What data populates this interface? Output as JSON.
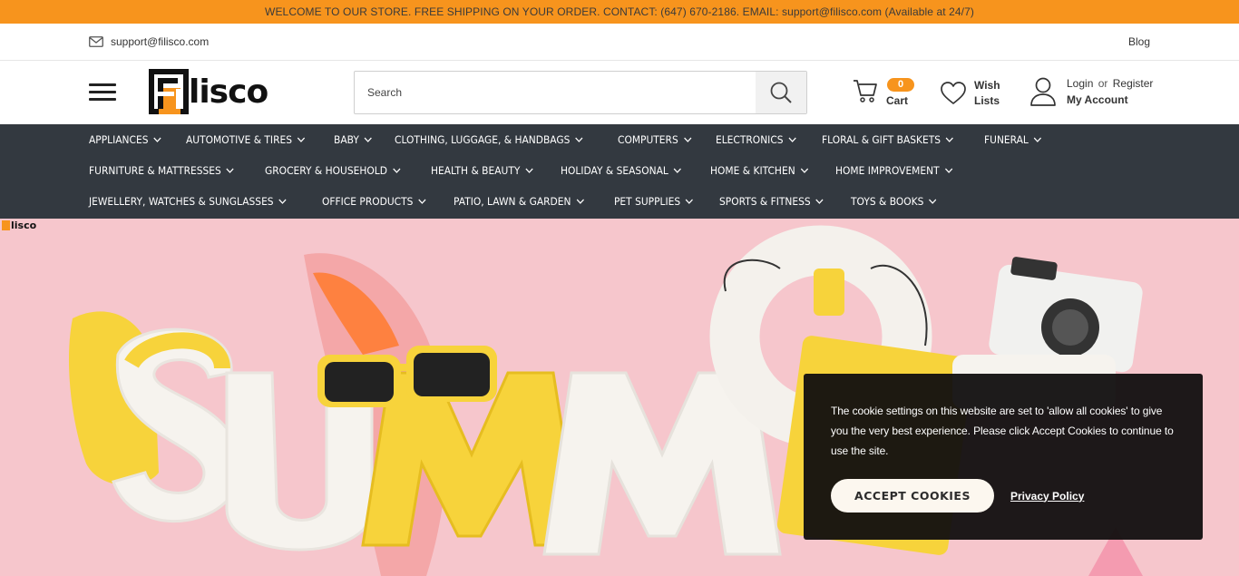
{
  "announcement": "WELCOME TO OUR STORE. FREE SHIPPING ON YOUR ORDER. CONTACT: (647) 670-2186. EMAIL: support@filisco.com (Available at 24/7)",
  "utility": {
    "email": "support@filisco.com",
    "blog": "Blog"
  },
  "header": {
    "logo_text": "Filisco",
    "search_placeholder": "Search",
    "cart_count": "0",
    "cart_label": "Cart",
    "wish_line1": "Wish",
    "wish_line2": "Lists",
    "login": "Login",
    "or": "or",
    "register": "Register",
    "my_account": "My Account"
  },
  "categories": {
    "row1": [
      "APPLIANCES",
      "AUTOMOTIVE & TIRES",
      "BABY",
      "CLOTHING, LUGGAGE, & HANDBAGS",
      "COMPUTERS",
      "ELECTRONICS",
      "FLORAL & GIFT BASKETS",
      "FUNERAL"
    ],
    "row2": [
      "FURNITURE & MATTRESSES",
      "GROCERY & HOUSEHOLD",
      "HEALTH & BEAUTY",
      "HOLIDAY & SEASONAL",
      "HOME & KITCHEN",
      "HOME IMPROVEMENT"
    ],
    "row3": [
      "JEWELLERY, WATCHES & SUNGLASSES",
      "OFFICE PRODUCTS",
      "PATIO, LAWN & GARDEN",
      "PET SUPPLIES",
      "SPORTS & FITNESS",
      "TOYS & BOOKS"
    ]
  },
  "hero": {
    "watermark": "lisco",
    "art_text": "SUMMER"
  },
  "cookie": {
    "text": "The cookie settings on this website are set to 'allow all cookies' to give you the very best experience. Please click Accept Cookies to continue to use the site.",
    "accept": "ACCEPT COOKIES",
    "privacy": "Privacy Policy"
  },
  "colors": {
    "accent": "#f7941d",
    "nav_bg": "#333940",
    "hero_bg": "#f6c6cc"
  }
}
